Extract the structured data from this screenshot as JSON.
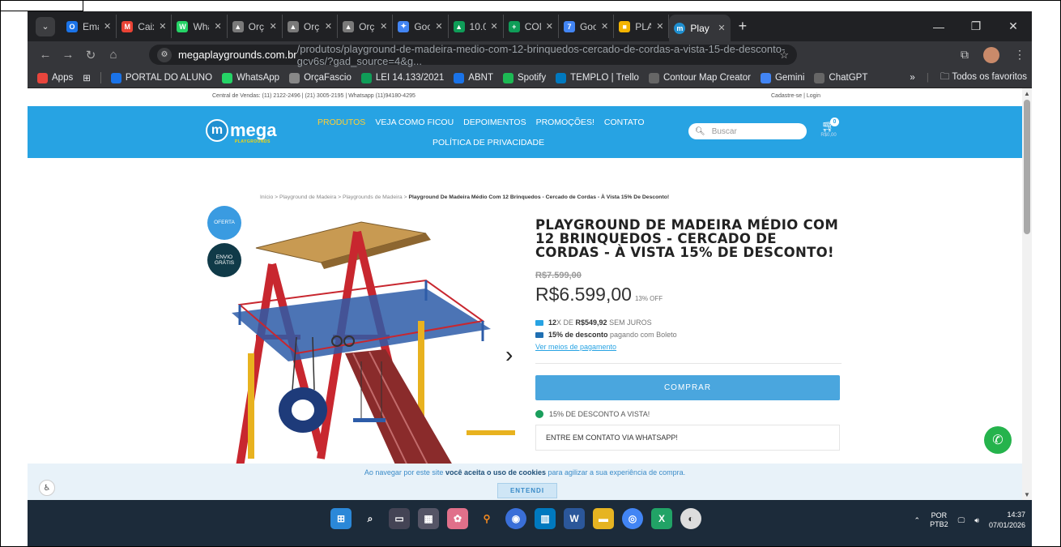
{
  "browser": {
    "tabs": [
      {
        "title": "Ema",
        "fav": "O",
        "fav_color": "#1a73e8"
      },
      {
        "title": "Caix",
        "fav": "M",
        "fav_color": "#ea4335"
      },
      {
        "title": "Wha",
        "fav": "W",
        "fav_color": "#25d366"
      },
      {
        "title": "Orç",
        "fav": "▲",
        "fav_color": "#7a7a7a"
      },
      {
        "title": "Orç",
        "fav": "▲",
        "fav_color": "#7a7a7a"
      },
      {
        "title": "Orç",
        "fav": "▲",
        "fav_color": "#7a7a7a"
      },
      {
        "title": "Goo",
        "fav": "✦",
        "fav_color": "#4285f4"
      },
      {
        "title": "10.0",
        "fav": "▲",
        "fav_color": "#0f9d58"
      },
      {
        "title": "CON",
        "fav": "+",
        "fav_color": "#0f9d58"
      },
      {
        "title": "Goo",
        "fav": "7",
        "fav_color": "#4285f4"
      },
      {
        "title": "PLA",
        "fav": "■",
        "fav_color": "#f4b400"
      }
    ],
    "active_tab": {
      "title": "Play",
      "fav": "m"
    },
    "url_host": "megaplaygrounds.com.br",
    "url_path": "/produtos/playground-de-madeira-medio-com-12-brinquedos-cercado-de-cordas-a-vista-15-de-desconto-gcv6s/?gad_source=4&g...",
    "bookmarks": [
      {
        "label": "Apps",
        "icon": "apps-icon",
        "color": "#e8453c"
      },
      {
        "label": "PORTAL DO ALUNO",
        "icon": "portal-icon",
        "color": "#1a73e8"
      },
      {
        "label": "WhatsApp",
        "icon": "whatsapp-icon",
        "color": "#25d366"
      },
      {
        "label": "OrçaFascio",
        "icon": "orca-icon",
        "color": "#888"
      },
      {
        "label": "LEI 14.133/2021",
        "icon": "lei-icon",
        "color": "#0f9d58"
      },
      {
        "label": "ABNT",
        "icon": "abnt-icon",
        "color": "#1a73e8"
      },
      {
        "label": "Spotify",
        "icon": "spotify-icon",
        "color": "#1db954"
      },
      {
        "label": "TEMPLO | Trello",
        "icon": "trello-icon",
        "color": "#0079bf"
      },
      {
        "label": "Contour Map Creator",
        "icon": "contour-icon",
        "color": "#666"
      },
      {
        "label": "Gemini",
        "icon": "gemini-icon",
        "color": "#4285f4"
      },
      {
        "label": "ChatGPT",
        "icon": "chatgpt-icon",
        "color": "#666"
      }
    ],
    "bookmarks_more": "»",
    "all_favorites": "Todos os favoritos"
  },
  "site": {
    "central": "Central de Vendas: (11) 2122-2496 | (21) 3005-2195 | Whatsapp (11)94180-4295",
    "signup": "Cadastre-se",
    "login": "Login",
    "logo_word": "mega",
    "logo_m": "m",
    "logo_sub": "PLAYGROUNDS",
    "nav": [
      "PRODUTOS",
      "VEJA COMO FICOU",
      "DEPOIMENTOS",
      "PROMOÇÕES!",
      "CONTATO"
    ],
    "nav2": "POLÍTICA DE PRIVACIDADE",
    "search_placeholder": "Buscar",
    "cart_count": "0",
    "cart_total": "R$0,00",
    "accent": "#27a3e3"
  },
  "breadcrumb": {
    "prefix": "Início > Playground de Madeira > Playgrounds de Madeira > ",
    "current": "Playground De Madeira Médio Com 12 Brinquedos - Cercado de Cordas - À Vista 15% De Desconto!"
  },
  "product": {
    "badge_offer": "OFERTA",
    "badge_shipping": "ENVIO GRÁTIS",
    "title": "PLAYGROUND DE MADEIRA MÉDIO COM 12 BRINQUEDOS - CERCADO DE CORDAS - À VISTA 15% DE DESCONTO!",
    "old_price": "R$7.599,00",
    "price": "R$6.599,00",
    "off": "13% OFF",
    "inst_count": "12",
    "inst_mid": "X DE ",
    "inst_value": "R$549,92",
    "inst_suffix": " SEM JUROS",
    "boleto_strong": "15% de desconto",
    "boleto_rest": " pagando com Boleto",
    "payment_link": "Ver meios de pagamento",
    "buy": "COMPRAR",
    "wa_discount": "15% DE DESCONTO A VISTA!",
    "wa_contact": "ENTRE EM CONTATO VIA WHATSAPP!"
  },
  "cookie": {
    "pre": "Ao navegar por este site ",
    "strong": "você aceita o uso de cookies",
    "post": " para agilizar a sua experiência de compra.",
    "ok": "ENTENDI"
  },
  "taskbar": {
    "lang1": "POR",
    "lang2": "PTB2",
    "time": "14:37",
    "date": "07/01/2026"
  }
}
